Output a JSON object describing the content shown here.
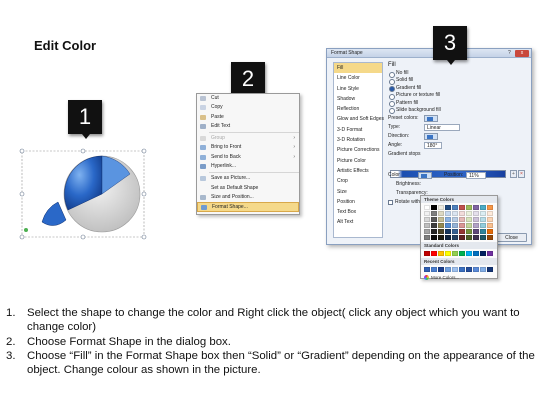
{
  "page": {
    "title": "Edit Color",
    "step_markers": [
      "1",
      "2",
      "3"
    ]
  },
  "context_menu": {
    "items": [
      {
        "label": "Cut",
        "disabled": false,
        "icon": "scissors-icon"
      },
      {
        "label": "Copy",
        "disabled": false,
        "icon": "copy-icon"
      },
      {
        "label": "Paste",
        "disabled": false,
        "icon": "paste-icon"
      },
      {
        "label": "Edit Text",
        "disabled": false,
        "icon": "edit-text-icon"
      },
      {
        "label": "Group",
        "disabled": true,
        "icon": "group-icon",
        "submenu": true
      },
      {
        "label": "Bring to Front",
        "disabled": false,
        "icon": "bring-front-icon",
        "submenu": true
      },
      {
        "label": "Send to Back",
        "disabled": false,
        "icon": "send-back-icon",
        "submenu": true
      },
      {
        "label": "Hyperlink...",
        "disabled": false,
        "icon": "hyperlink-icon"
      },
      {
        "label": "Save as Picture...",
        "disabled": false,
        "icon": "save-picture-icon"
      },
      {
        "label": "Set as Default Shape",
        "disabled": false,
        "icon": ""
      },
      {
        "label": "Size and Position...",
        "disabled": false,
        "icon": "size-position-icon"
      },
      {
        "label": "Format Shape...",
        "disabled": false,
        "icon": "format-shape-icon",
        "highlighted": true
      }
    ]
  },
  "dialog": {
    "title": "Format Shape",
    "help": "?",
    "close_glyph": "x",
    "nav": [
      "Fill",
      "Line Color",
      "Line Style",
      "Shadow",
      "Reflection",
      "Glow and Soft Edges",
      "3-D Format",
      "3-D Rotation",
      "Picture Corrections",
      "Picture Color",
      "Artistic Effects",
      "Crop",
      "Size",
      "Position",
      "Text Box",
      "Alt Text"
    ],
    "active_nav": "Fill",
    "fill_heading": "Fill",
    "fill_options": [
      {
        "label": "No fill",
        "selected": false
      },
      {
        "label": "Solid fill",
        "selected": false
      },
      {
        "label": "Gradient fill",
        "selected": true
      },
      {
        "label": "Picture or texture fill",
        "selected": false
      },
      {
        "label": "Pattern fill",
        "selected": false
      },
      {
        "label": "Slide background fill",
        "selected": false
      }
    ],
    "preset_colors_label": "Preset colors:",
    "type_label": "Type:",
    "type_value": "Linear",
    "direction_label": "Direction:",
    "angle_label": "Angle:",
    "angle_value": "180°",
    "gradient_stops_label": "Gradient stops",
    "color_label": "Color",
    "position_label": "Position:",
    "position_value": "11%",
    "brightness_label": "Brightness:",
    "transparency_label": "Transparency:",
    "rotate_label": "Rotate with shape",
    "close_button": "Close"
  },
  "palette": {
    "theme_label": "Theme Colors",
    "standard_label": "Standard Colors",
    "recent_label": "Recent Colors",
    "more_label": "More Colors...",
    "theme_top": [
      "#ffffff",
      "#000000",
      "#eeece1",
      "#1f497d",
      "#4f81bd",
      "#c0504d",
      "#9bbb59",
      "#8064a2",
      "#4bacc6",
      "#f79646"
    ],
    "theme_shades": [
      [
        "#f2f2f2",
        "#7f7f7f",
        "#ddd9c3",
        "#c6d9f0",
        "#dbe5f1",
        "#f2dcdb",
        "#ebf1dd",
        "#e5e0ec",
        "#dbeef3",
        "#fdeada"
      ],
      [
        "#d8d8d8",
        "#595959",
        "#c4bd97",
        "#8db3e2",
        "#b8cce4",
        "#e5b9b7",
        "#d7e3bc",
        "#ccc1d9",
        "#b7dde8",
        "#fbd5b5"
      ],
      [
        "#bfbfbf",
        "#3f3f3f",
        "#938953",
        "#548dd4",
        "#95b3d7",
        "#d99694",
        "#c3d69b",
        "#b2a2c7",
        "#92cddc",
        "#fac08f"
      ],
      [
        "#a5a5a5",
        "#262626",
        "#494429",
        "#17365d",
        "#366092",
        "#953734",
        "#76923c",
        "#5f497a",
        "#31859b",
        "#e36c09"
      ],
      [
        "#7f7f7f",
        "#0c0c0c",
        "#1d1b10",
        "#0f243e",
        "#244061",
        "#632423",
        "#4f6128",
        "#3f3151",
        "#205867",
        "#974806"
      ]
    ],
    "standard": [
      "#c00000",
      "#ff0000",
      "#ffc000",
      "#ffff00",
      "#92d050",
      "#00b050",
      "#00b0f0",
      "#0070c0",
      "#002060",
      "#7030a0"
    ],
    "recent": [
      "#2f5fb3",
      "#4a7fd0",
      "#1a3f8f",
      "#6fa0e0",
      "#9dc0ee",
      "#3a6fc0",
      "#254e9c",
      "#5a8ad8",
      "#82aee6",
      "#143576"
    ]
  },
  "instructions": [
    {
      "num": "1.",
      "text": "Select the shape to change the color and Right click the object( click any object which you want to change color)"
    },
    {
      "num": "2.",
      "text": "Choose Format Shape in the dialog box."
    },
    {
      "num": "3.",
      "text": "Choose “Fill” in the Format Shape box then “Solid” or “Gradient” depending on the appearance of the object. Change colour as shown in the picture."
    }
  ]
}
